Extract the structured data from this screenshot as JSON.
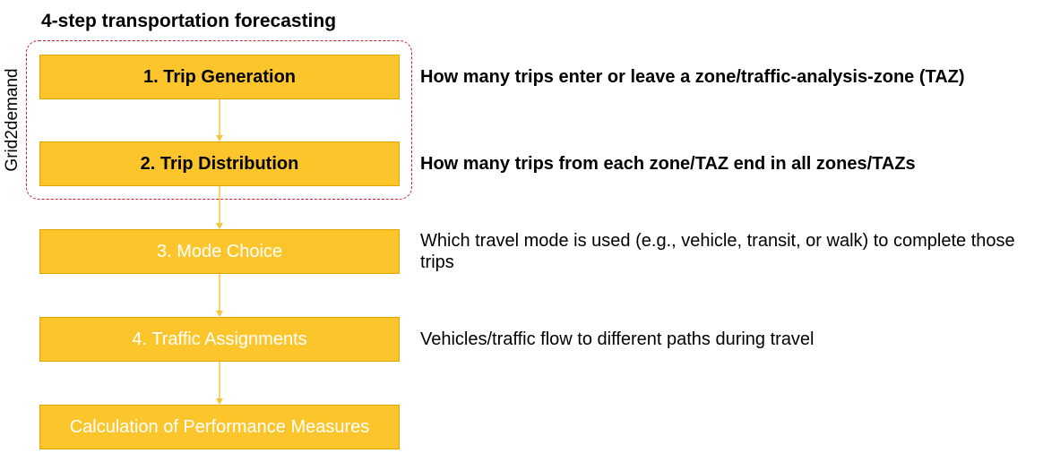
{
  "title": "4-step transportation forecasting",
  "group_label": "Grid2demand",
  "colors": {
    "box_fill": "#fdc52c",
    "box_border": "#e6a400",
    "arrow": "#f7c53a",
    "group_border": "#c0202a"
  },
  "steps": [
    {
      "label": "1. Trip Generation",
      "emphasis": true
    },
    {
      "label": "2. Trip Distribution",
      "emphasis": true
    },
    {
      "label": "3. Mode Choice",
      "emphasis": false
    },
    {
      "label": "4. Traffic Assignments",
      "emphasis": false
    },
    {
      "label": "Calculation of Performance Measures",
      "emphasis": false
    }
  ],
  "descriptions": [
    {
      "text": "How many trips enter or leave a zone/traffic-analysis-zone (TAZ)",
      "emphasis": true
    },
    {
      "text": "How many trips from each zone/TAZ end in all zones/TAZs",
      "emphasis": true
    },
    {
      "text": "Which travel mode is used (e.g., vehicle, transit, or walk) to complete those trips",
      "emphasis": false
    },
    {
      "text": "Vehicles/traffic flow to different paths during travel",
      "emphasis": false
    }
  ]
}
